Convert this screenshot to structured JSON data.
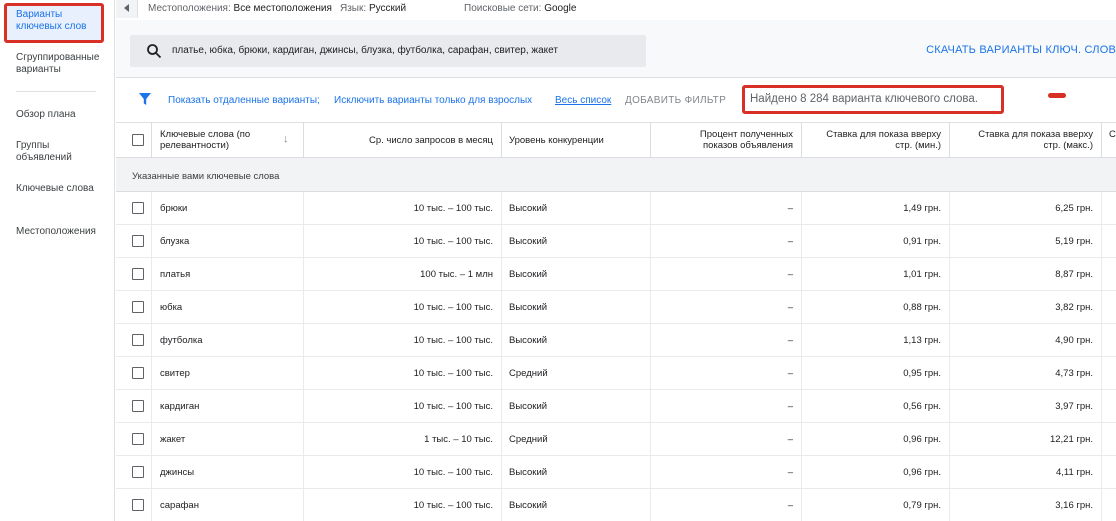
{
  "sidebar": {
    "items": [
      {
        "label": "Варианты ключевых слов"
      },
      {
        "label": "Сгруппированные варианты"
      },
      {
        "label": "Обзор плана"
      },
      {
        "label": "Группы объявлений"
      },
      {
        "label": "Ключевые слова"
      },
      {
        "label": "Местоположения"
      }
    ]
  },
  "topbar": {
    "locations_label": "Местоположения:",
    "locations_value": "Все местоположения",
    "language_label": "Язык:",
    "language_value": "Русский",
    "networks_label": "Поисковые сети:",
    "networks_value": "Google"
  },
  "search": {
    "value": "платье, юбка, брюки, кардиган, джинсы, блузка, футболка, сарафан, свитер, жакет"
  },
  "download_label": "СКАЧАТЬ ВАРИАНТЫ КЛЮЧ. СЛОВ",
  "filters": {
    "show_distant": "Показать отдаленные варианты;",
    "exclude_adult": "Исключить варианты только для взрослых",
    "whole_list": "Весь список",
    "add_filter": "ДОБАВИТЬ ФИЛЬТР",
    "found": "Найдено 8 284 варианта ключевого слова."
  },
  "colors": {
    "accent": "#1a73e8",
    "highlight_red": "#d93025"
  },
  "table": {
    "headers": {
      "keyword": "Ключевые слова (по релевантности)",
      "avg_searches": "Ср. число запросов в месяц",
      "competition": "Уровень конкуренции",
      "impr_share": "Процент полученных показов объявления",
      "bid_low": "Ставка для показа вверху стр. (мин.)",
      "bid_high": "Ставка для показа вверху стр. (макс.)",
      "next": "Ст"
    },
    "group_label": "Указанные вами ключевые слова",
    "rows": [
      {
        "keyword": "брюки",
        "searches": "10 тыс. – 100 тыс.",
        "competition": "Высокий",
        "share": "–",
        "bid_low": "1,49 грн.",
        "bid_high": "6,25 грн."
      },
      {
        "keyword": "блузка",
        "searches": "10 тыс. – 100 тыс.",
        "competition": "Высокий",
        "share": "–",
        "bid_low": "0,91 грн.",
        "bid_high": "5,19 грн."
      },
      {
        "keyword": "платья",
        "searches": "100 тыс. – 1 млн",
        "competition": "Высокий",
        "share": "–",
        "bid_low": "1,01 грн.",
        "bid_high": "8,87 грн."
      },
      {
        "keyword": "юбка",
        "searches": "10 тыс. – 100 тыс.",
        "competition": "Высокий",
        "share": "–",
        "bid_low": "0,88 грн.",
        "bid_high": "3,82 грн."
      },
      {
        "keyword": "футболка",
        "searches": "10 тыс. – 100 тыс.",
        "competition": "Высокий",
        "share": "–",
        "bid_low": "1,13 грн.",
        "bid_high": "4,90 грн."
      },
      {
        "keyword": "свитер",
        "searches": "10 тыс. – 100 тыс.",
        "competition": "Средний",
        "share": "–",
        "bid_low": "0,95 грн.",
        "bid_high": "4,73 грн."
      },
      {
        "keyword": "кардиган",
        "searches": "10 тыс. – 100 тыс.",
        "competition": "Высокий",
        "share": "–",
        "bid_low": "0,56 грн.",
        "bid_high": "3,97 грн."
      },
      {
        "keyword": "жакет",
        "searches": "1 тыс. – 10 тыс.",
        "competition": "Средний",
        "share": "–",
        "bid_low": "0,96 грн.",
        "bid_high": "12,21 грн."
      },
      {
        "keyword": "джинсы",
        "searches": "10 тыс. – 100 тыс.",
        "competition": "Высокий",
        "share": "–",
        "bid_low": "0,96 грн.",
        "bid_high": "4,11 грн."
      },
      {
        "keyword": "сарафан",
        "searches": "10 тыс. – 100 тыс.",
        "competition": "Высокий",
        "share": "–",
        "bid_low": "0,79 грн.",
        "bid_high": "3,16 грн."
      }
    ]
  }
}
